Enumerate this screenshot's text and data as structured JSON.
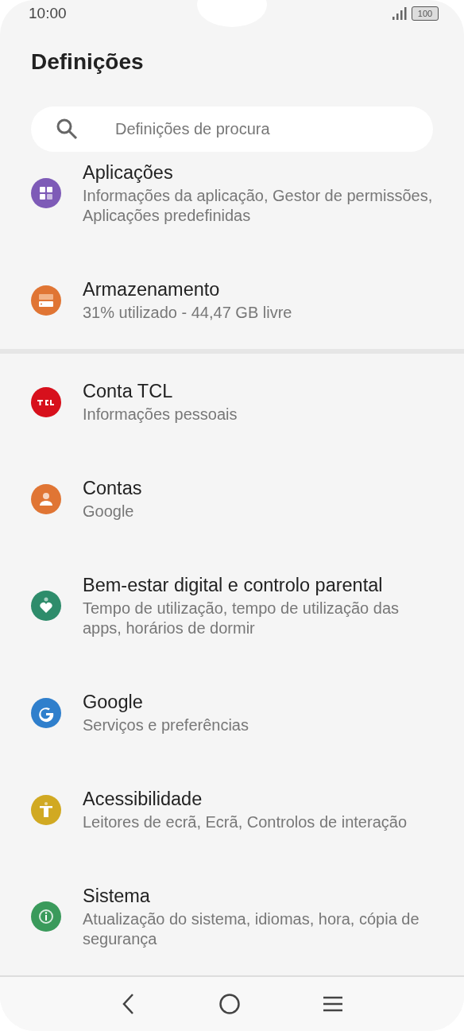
{
  "status_bar": {
    "time": "10:00",
    "battery": "100"
  },
  "title": "Definições",
  "search": {
    "placeholder": "Definições de procura"
  },
  "groups": [
    [
      {
        "kind": "apps",
        "color": "#7e5bb7",
        "title": "Aplicações",
        "subtitle": "Informações da aplicação, Gestor de permissões, Aplicações predefinidas"
      },
      {
        "kind": "storage",
        "color": "#e07534",
        "title": "Armazenamento",
        "subtitle": "31% utilizado - 44,47 GB livre"
      }
    ],
    [
      {
        "kind": "tcl",
        "color": "#d7101c",
        "title": "Conta TCL",
        "subtitle": "Informações pessoais"
      },
      {
        "kind": "person",
        "color": "#e07534",
        "title": "Contas",
        "subtitle": "Google"
      },
      {
        "kind": "wellbeing",
        "color": "#2e8c6b",
        "title": "Bem-estar digital e controlo parental",
        "subtitle": "Tempo de utilização, tempo de utilização das apps, horários de dormir"
      },
      {
        "kind": "google",
        "color": "#2f7fcc",
        "title": "Google",
        "subtitle": "Serviços e preferências"
      },
      {
        "kind": "accessibility",
        "color": "#d1a922",
        "title": "Acessibilidade",
        "subtitle": "Leitores de ecrã, Ecrã, Controlos de interação"
      },
      {
        "kind": "info",
        "color": "#3a9a5b",
        "title": "Sistema",
        "subtitle": "Atualização do sistema, idiomas, hora, cópia de segurança"
      }
    ]
  ]
}
